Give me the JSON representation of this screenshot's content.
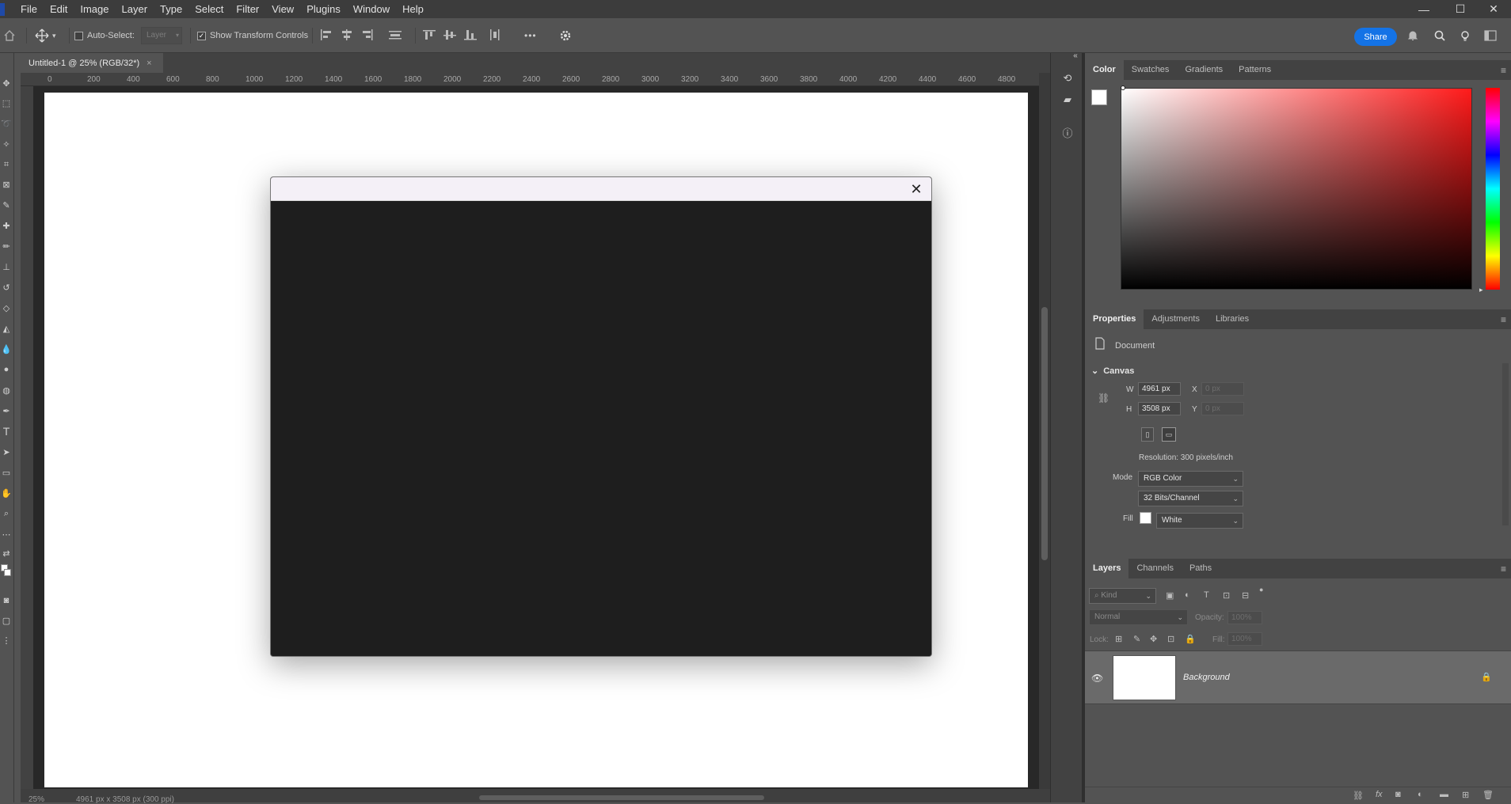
{
  "menubar": {
    "items": [
      "File",
      "Edit",
      "Image",
      "Layer",
      "Type",
      "Select",
      "Filter",
      "View",
      "Plugins",
      "Window",
      "Help"
    ]
  },
  "window_controls": {
    "minimize": "—",
    "maximize": "☐",
    "close": "✕"
  },
  "options_bar": {
    "auto_select_label": "Auto-Select:",
    "auto_select_checked": false,
    "target_value": "Layer",
    "show_transform_label": "Show Transform Controls",
    "show_transform_checked": true,
    "more_label": "•••",
    "share_label": "Share"
  },
  "document": {
    "tab_title": "Untitled-1 @ 25% (RGB/32*)",
    "ruler_ticks": [
      "0",
      "200",
      "400",
      "600",
      "800",
      "1000",
      "1200",
      "1400",
      "1600",
      "1800",
      "2000",
      "2200",
      "2400",
      "2600",
      "2800",
      "3000",
      "3200",
      "3400",
      "3600",
      "3800",
      "4000",
      "4200",
      "4400",
      "4600",
      "4800"
    ],
    "zoom": "25%",
    "status_info": "4961 px x 3508 px (300 ppi)"
  },
  "dialog": {
    "close_glyph": "✕"
  },
  "color_panel": {
    "tabs": [
      "Color",
      "Swatches",
      "Gradients",
      "Patterns"
    ],
    "active_tab": "Color",
    "hue_color": "#ff1a1a"
  },
  "properties_panel": {
    "tabs": [
      "Properties",
      "Adjustments",
      "Libraries"
    ],
    "active_tab": "Properties",
    "type_label": "Document",
    "section_label": "Canvas",
    "w_label": "W",
    "w_value": "4961 px",
    "h_label": "H",
    "h_value": "3508 px",
    "x_label": "X",
    "x_placeholder": "0 px",
    "y_label": "Y",
    "y_placeholder": "0 px",
    "resolution": "Resolution: 300 pixels/inch",
    "mode_label": "Mode",
    "mode_value": "RGB Color",
    "bits_value": "32 Bits/Channel",
    "fill_label": "Fill",
    "fill_value": "White"
  },
  "layers_panel": {
    "tabs": [
      "Layers",
      "Channels",
      "Paths"
    ],
    "active_tab": "Layers",
    "kind_placeholder": "Kind",
    "blend_mode": "Normal",
    "opacity_label": "Opacity:",
    "opacity_value": "100%",
    "lock_label": "Lock:",
    "fill_label": "Fill:",
    "fill_value": "100%",
    "layers": [
      {
        "name": "Background",
        "visible": true,
        "locked": true
      }
    ]
  }
}
